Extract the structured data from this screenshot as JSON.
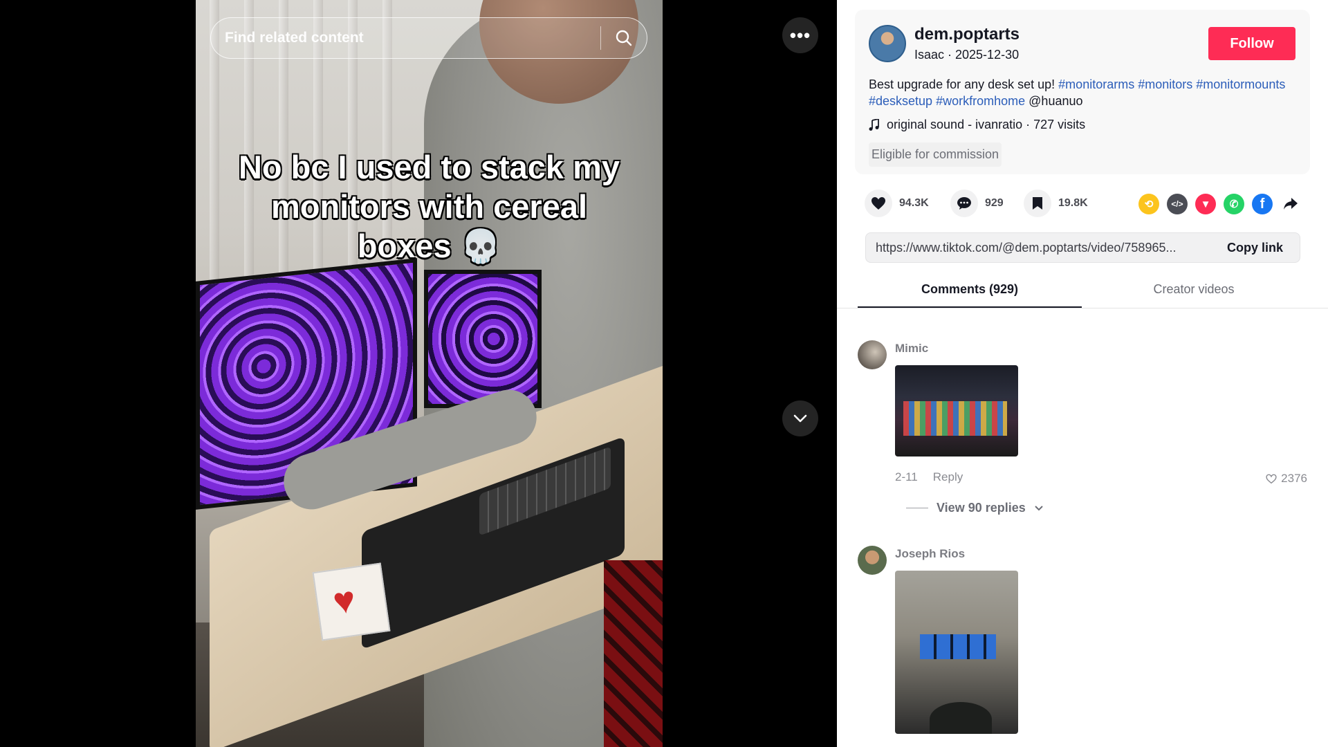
{
  "search": {
    "placeholder": "Find related content"
  },
  "video": {
    "caption": "No bc I used to stack my monitors with cereal boxes 💀",
    "more_icon": "more-horizontal-icon",
    "next_icon": "chevron-down-icon"
  },
  "author": {
    "handle": "dem.poptarts",
    "meta": "Isaac · 2025-12-30",
    "follow_label": "Follow"
  },
  "description": {
    "text": "Best upgrade for any desk set up! ",
    "hashtags": [
      "#monitorarms",
      "#monitors",
      "#monitormounts",
      "#desksetup",
      "#workfromhome"
    ],
    "mention": "@huanuo"
  },
  "sound": {
    "icon": "music-note-icon",
    "text": "original sound - ivanratio · 727 visits"
  },
  "commission": "Eligible for commission",
  "stats": {
    "likes": "94.3K",
    "comments": "929",
    "saves": "19.8K"
  },
  "share_icons": [
    {
      "name": "repost-icon",
      "color": "#fcc41d"
    },
    {
      "name": "embed-icon",
      "color": "#4b4d55"
    },
    {
      "name": "send-to-friends-icon",
      "color": "#fe2c55"
    },
    {
      "name": "whatsapp-icon",
      "color": "#25d366"
    },
    {
      "name": "facebook-icon",
      "color": "#1877f2"
    },
    {
      "name": "share-more-icon",
      "color": "#161823"
    }
  ],
  "link": {
    "url": "https://www.tiktok.com/@dem.poptarts/video/758965...",
    "copy_label": "Copy link"
  },
  "tabs": {
    "comments": "Comments (929)",
    "creator": "Creator videos"
  },
  "comments": [
    {
      "name": "Mimic",
      "date": "2-11",
      "reply": "Reply",
      "likes": "2376",
      "replies": "View 90 replies"
    },
    {
      "name": "Joseph Rios"
    }
  ],
  "colors": {
    "accent": "#fe2c55",
    "hashtag": "#2b5db9"
  }
}
